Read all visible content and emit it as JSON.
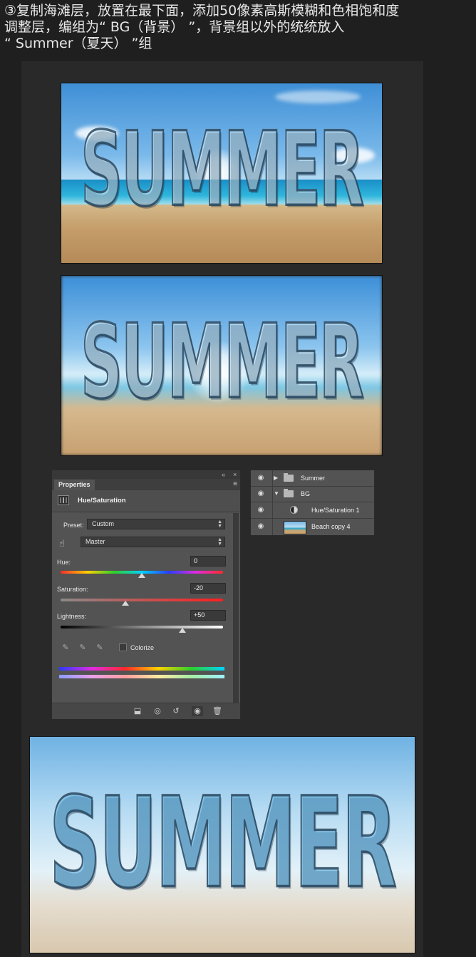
{
  "instruction": {
    "line1": "③复制海滩层，放置在最下面，添加50像素高斯模糊和色相饱和度",
    "line2": "调整层，编组为“ BG（背景） ”，背景组以外的统统放入",
    "line3": "“ Summer（夏天） ”组"
  },
  "images": {
    "word": "SUMMER"
  },
  "properties_panel": {
    "tab_label": "Properties",
    "title": "Hue/Saturation",
    "preset_label": "Preset:",
    "preset_value": "Custom",
    "channel_value": "Master",
    "hue_label": "Hue:",
    "hue_value": "0",
    "hue_position": 0.5,
    "saturation_label": "Saturation:",
    "saturation_value": "-20",
    "saturation_position": 0.4,
    "lightness_label": "Lightness:",
    "lightness_value": "+50",
    "lightness_position": 0.75,
    "colorize_label": "Colorize",
    "colorize_checked": false
  },
  "layers_panel": {
    "layers": [
      {
        "name": "Summer",
        "type": "group",
        "expanded": false
      },
      {
        "name": "BG",
        "type": "group",
        "expanded": true
      },
      {
        "name": "Hue/Saturation 1",
        "type": "adjustment"
      },
      {
        "name": "Beach copy 4",
        "type": "image"
      }
    ]
  },
  "icons": {
    "eye": "visibility-eye-icon",
    "folder": "folder-icon",
    "hand": "targeted-adjustment-hand-icon",
    "eyedropper": "eyedropper-icon",
    "trash": "trash-icon"
  }
}
